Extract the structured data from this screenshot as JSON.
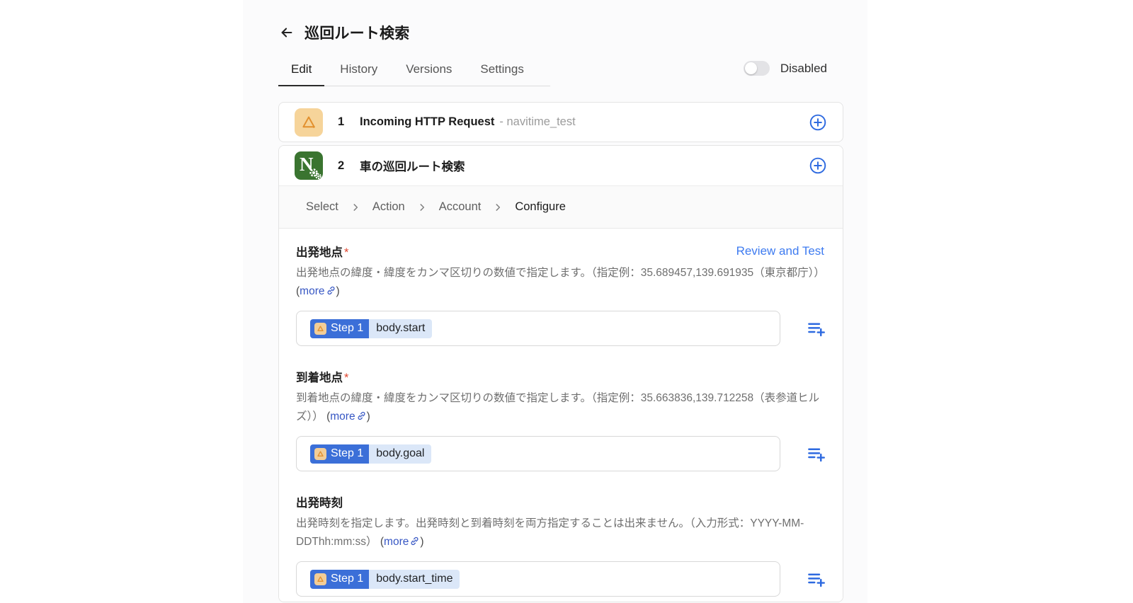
{
  "header": {
    "title": "巡回ルート検索"
  },
  "tabs": [
    {
      "label": "Edit",
      "active": true
    },
    {
      "label": "History",
      "active": false
    },
    {
      "label": "Versions",
      "active": false
    },
    {
      "label": "Settings",
      "active": false
    }
  ],
  "toggle": {
    "label": "Disabled",
    "state": "off"
  },
  "steps": [
    {
      "number": "1",
      "title": "Incoming HTTP Request",
      "subtitle": "- navitime_test",
      "app": "anyflow-http-trigger"
    },
    {
      "number": "2",
      "title": "車の巡回ルート検索",
      "subtitle": "",
      "app": "navitime"
    }
  ],
  "breadcrumb": {
    "items": [
      {
        "label": "Select",
        "active": false
      },
      {
        "label": "Action",
        "active": false
      },
      {
        "label": "Account",
        "active": false
      },
      {
        "label": "Configure",
        "active": true
      }
    ]
  },
  "configure": {
    "review_link": "Review and Test",
    "more": {
      "open": "(",
      "label": "more",
      "close": ")"
    },
    "required_mark": "*",
    "fields": [
      {
        "label": "出発地点",
        "required": true,
        "description": "出発地点の緯度・緯度をカンマ区切りの数値で指定します。（指定例：35.689457,139.691935（東京都庁））",
        "chip": {
          "step": "Step 1",
          "token": "body.start"
        }
      },
      {
        "label": "到着地点",
        "required": true,
        "description": "到着地点の緯度・緯度をカンマ区切りの数値で指定します。（指定例：35.663836,139.712258（表参道ヒルズ））",
        "chip": {
          "step": "Step 1",
          "token": "body.goal"
        }
      },
      {
        "label": "出発時刻",
        "required": false,
        "description": "出発時刻を指定します。出発時刻と到着時刻を両方指定することは出来ません。（入力形式：YYYY-MM-DDThh:mm:ss）",
        "chip": {
          "step": "Step 1",
          "token": "body.start_time"
        }
      }
    ]
  },
  "colors": {
    "accent_blue": "#2e6ae0",
    "link_blue": "#3757c4",
    "review_blue": "#3e7bf0",
    "chip_blue": "#3b6fd8",
    "chip_token_bg": "#dbe7f8",
    "http_icon_bg": "#f6d49a",
    "http_icon_fg": "#e2902e",
    "navitime_green": "#3a7430",
    "required_red": "#e0452e"
  }
}
